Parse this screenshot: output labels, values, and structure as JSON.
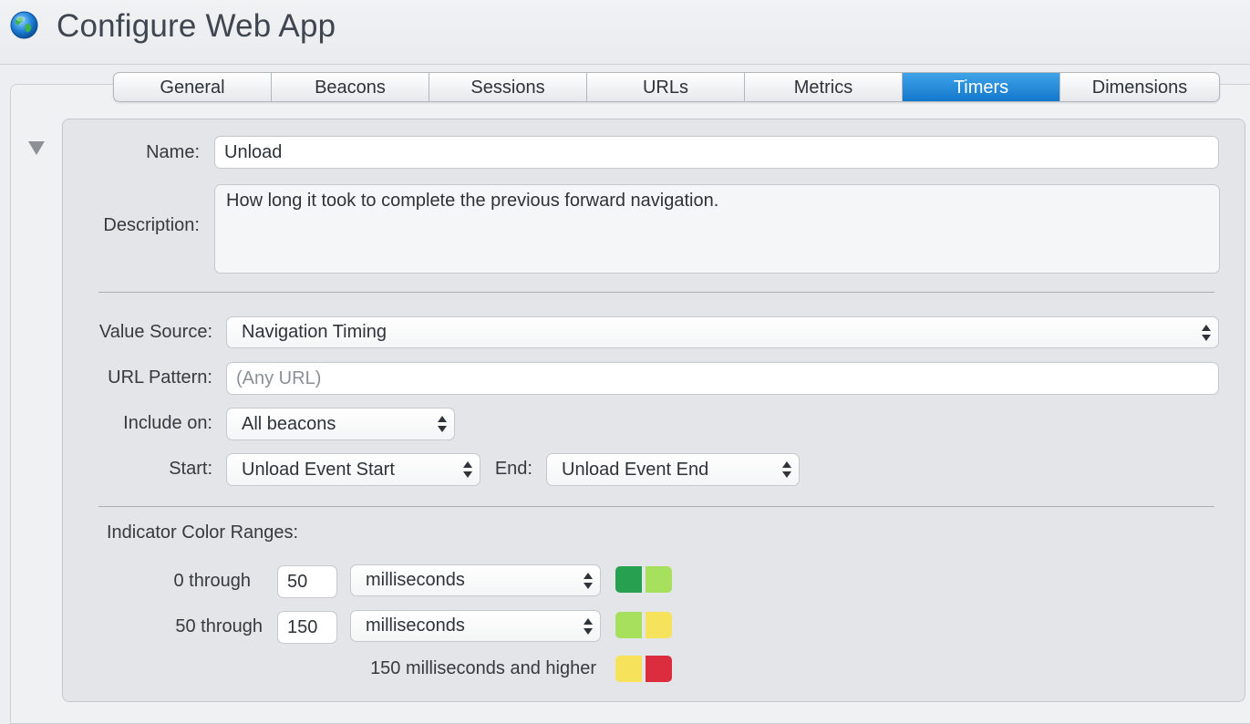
{
  "app": {
    "title": "Configure Web App",
    "icon": "globe-icon"
  },
  "tabs": [
    {
      "label": "General",
      "active": false
    },
    {
      "label": "Beacons",
      "active": false
    },
    {
      "label": "Sessions",
      "active": false
    },
    {
      "label": "URLs",
      "active": false
    },
    {
      "label": "Metrics",
      "active": false
    },
    {
      "label": "Timers",
      "active": true
    },
    {
      "label": "Dimensions",
      "active": false
    }
  ],
  "timer": {
    "name_label": "Name:",
    "name_value": "Unload",
    "description_label": "Description:",
    "description_value": "How long it took to complete the previous forward navigation.",
    "value_source_label": "Value Source:",
    "value_source_value": "Navigation Timing",
    "url_pattern_label": "URL Pattern:",
    "url_pattern_placeholder": "(Any URL)",
    "include_on_label": "Include on:",
    "include_on_value": "All beacons",
    "start_label": "Start:",
    "start_value": "Unload Event Start",
    "end_label": "End:",
    "end_value": "Unload Event End"
  },
  "indicator": {
    "heading": "Indicator Color Ranges:",
    "ranges": [
      {
        "prefix": "0 through",
        "value": "50",
        "unit": "milliseconds",
        "colors": [
          "#27a04f",
          "#a6e05c"
        ]
      },
      {
        "prefix": "50 through",
        "value": "150",
        "unit": "milliseconds",
        "colors": [
          "#a6e05c",
          "#f7e25b"
        ]
      }
    ],
    "final_text": "150 milliseconds and higher",
    "final_colors": [
      "#f7e25b",
      "#dc2d3f"
    ]
  },
  "colors": {
    "accent": "#1e88d8"
  }
}
